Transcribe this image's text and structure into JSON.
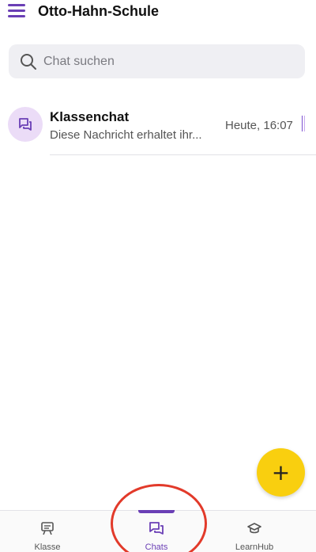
{
  "header": {
    "title": "Otto-Hahn-Schule",
    "menu_icon": "hamburger-menu-icon"
  },
  "search": {
    "placeholder": "Chat suchen",
    "value": "",
    "icon": "search-icon"
  },
  "chats": [
    {
      "name": "Klassenchat",
      "preview": "Diese Nachricht erhaltet ihr...",
      "time": "Heute, 16:07",
      "icon": "chat-bubble-icon"
    }
  ],
  "fab": {
    "label": "+",
    "icon": "plus-icon"
  },
  "bottom_nav": {
    "items": [
      {
        "label": "Klasse",
        "icon": "classroom-board-icon",
        "active": false
      },
      {
        "label": "Chats",
        "icon": "chat-bubble-icon",
        "active": true
      },
      {
        "label": "LearnHub",
        "icon": "graduation-cap-icon",
        "active": false
      }
    ]
  },
  "colors": {
    "accent": "#6a3fb5",
    "avatar_bg": "#ebdcf7",
    "fab": "#f9cf0f",
    "annotation": "#e23a2a"
  }
}
